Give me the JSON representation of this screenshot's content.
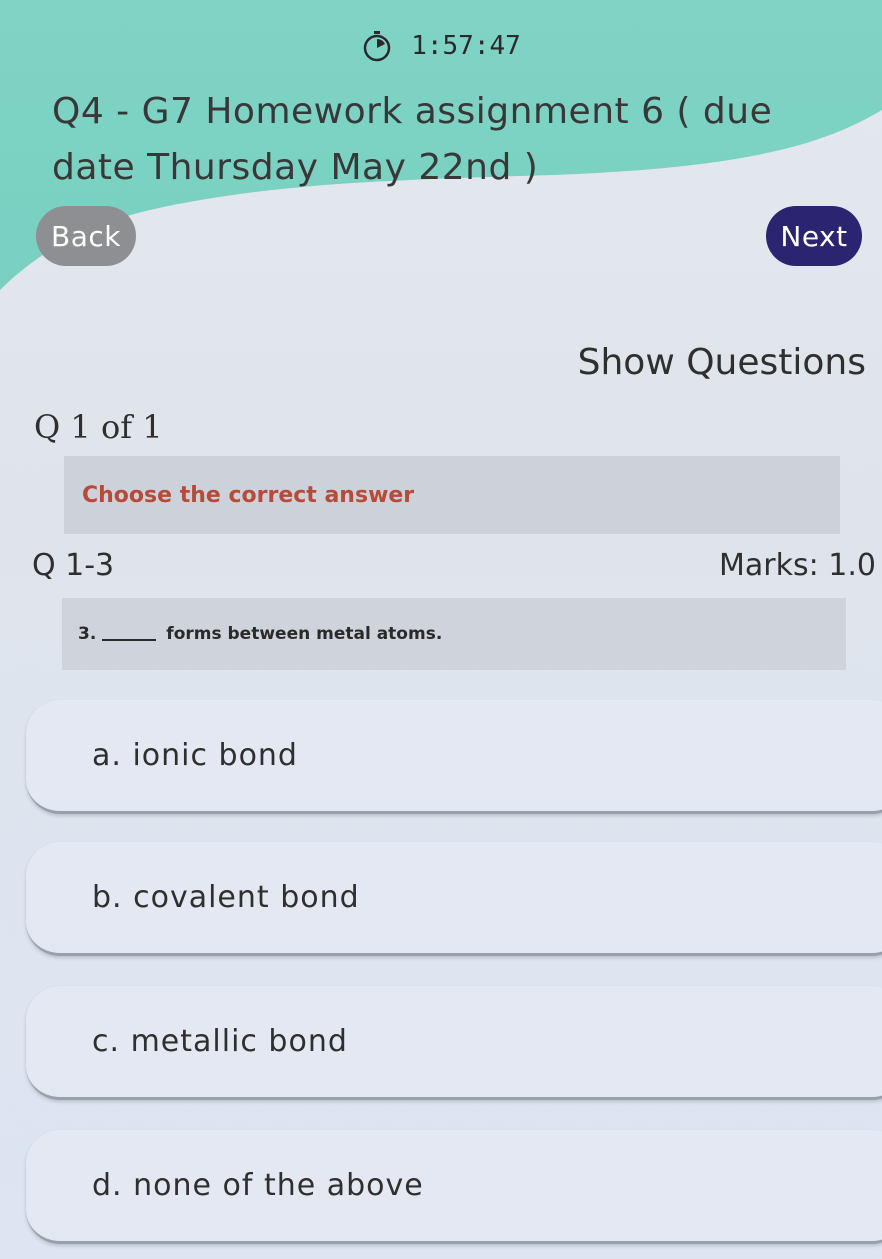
{
  "timer": {
    "value": "1:57:47",
    "icon": "stopwatch-icon"
  },
  "header": {
    "title": "Q4 - G7 Homework assignment 6 ( due date Thursday May 22nd )",
    "accent_color": "#6fcfbd"
  },
  "nav": {
    "back_label": "Back",
    "next_label": "Next",
    "back_color": "#8e8f93",
    "next_color": "#2b2470"
  },
  "show_questions_label": "Show Questions",
  "question_counter": "Q 1 of 1",
  "instruction": "Choose the correct answer",
  "question": {
    "number_label": "Q 1-3",
    "marks_label": "Marks: 1.0",
    "prefix": "3.",
    "text": "forms between metal atoms."
  },
  "options": [
    {
      "label": "a. ionic bond"
    },
    {
      "label": "b. covalent bond"
    },
    {
      "label": "c. metallic bond"
    },
    {
      "label": "d. none of the above"
    }
  ]
}
